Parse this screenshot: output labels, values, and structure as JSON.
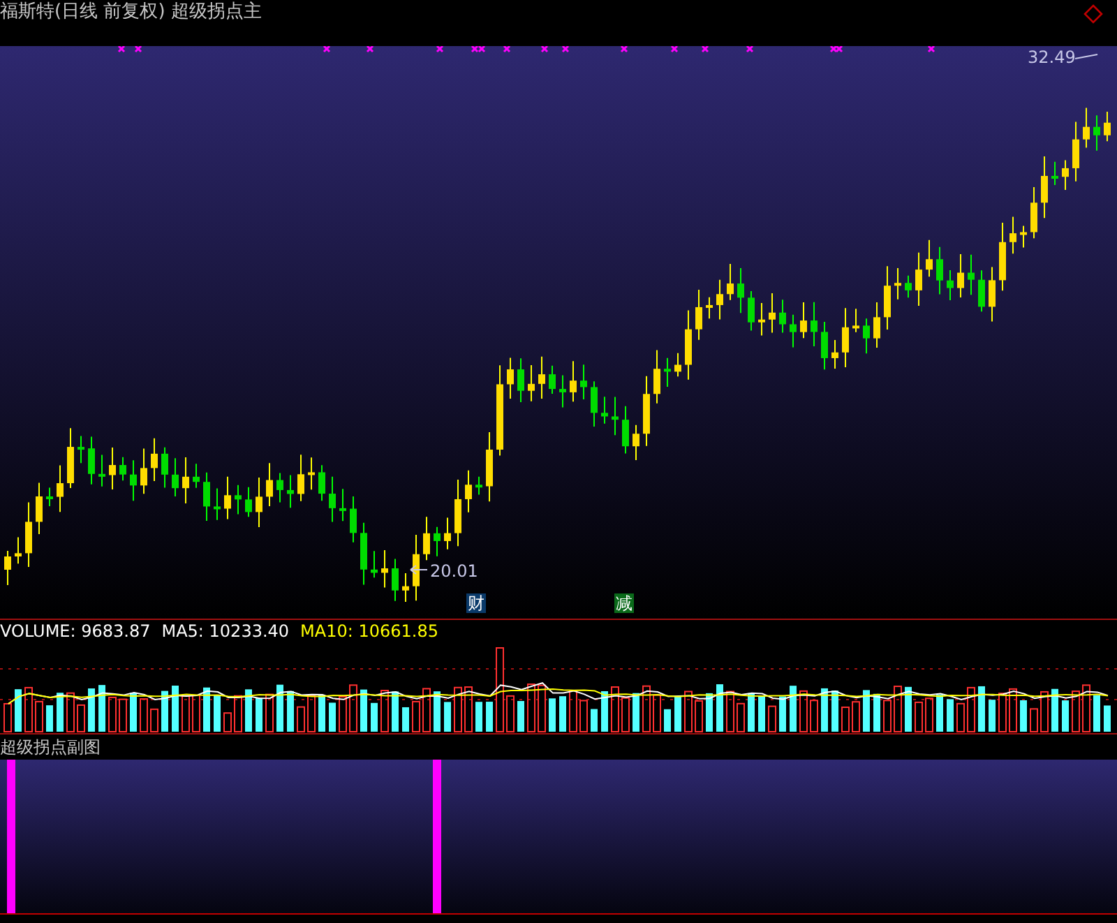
{
  "title": "福斯特(日线 前复权) 超级拐点主",
  "main": {
    "high_label": "32.49",
    "low_label": "20.01",
    "markers": [
      {
        "text": "财",
        "color": "#0a3a6a"
      },
      {
        "text": "减",
        "color": "#0a6a1a"
      }
    ]
  },
  "volume": {
    "legend": [
      {
        "label": "VOLUME:",
        "value": "9683.87",
        "color": "#ffffff"
      },
      {
        "label": "MA5:",
        "value": "10233.40",
        "color": "#ffffff"
      },
      {
        "label": "MA10:",
        "value": "10661.85",
        "color": "#ffff00"
      }
    ]
  },
  "sub": {
    "title": "超级拐点副图"
  }
}
